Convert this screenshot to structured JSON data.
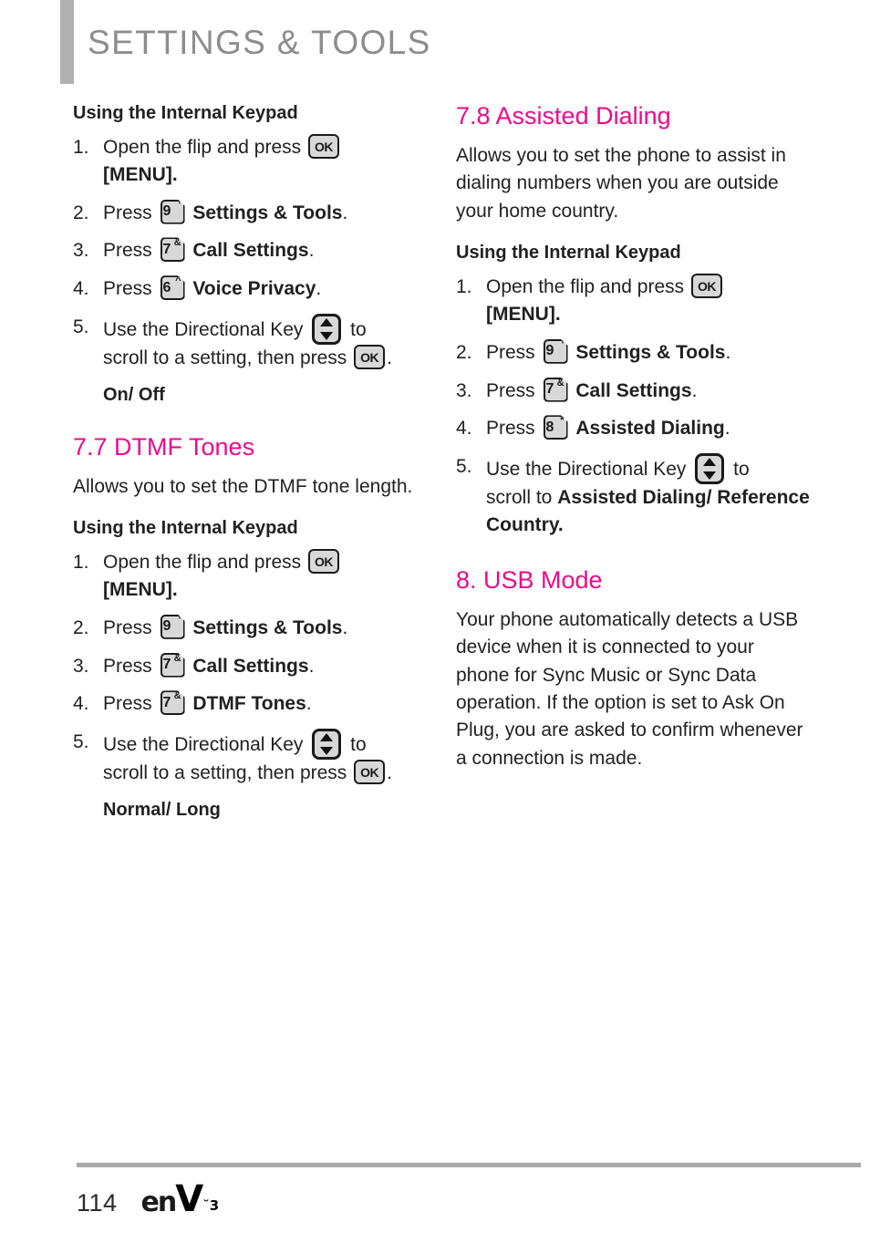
{
  "header": {
    "title": "SETTINGS & TOOLS",
    "accent_gray": "#8d8d8d",
    "bar_color": "#b0b0b0"
  },
  "colors": {
    "heading_magenta": "#ec0a8c",
    "body_black": "#231f20"
  },
  "left_column": {
    "blocks": [
      {
        "kind": "sub-heading",
        "text": "Using the Internal Keypad"
      },
      {
        "kind": "steps",
        "items": [
          {
            "num": "1.",
            "pre": "Open the flip and press ",
            "icon": "ok-key",
            "post": "",
            "line2_bold": "[MENU]."
          },
          {
            "num": "2.",
            "pre": "Press ",
            "icon": "num-key",
            "key_digit": "9",
            "key_sup": "‘",
            "post_bold": "Settings & Tools",
            "post": "."
          },
          {
            "num": "3.",
            "pre": "Press ",
            "icon": "num-key",
            "key_digit": "7",
            "key_sup": "&",
            "post_bold": "Call Settings",
            "post": "."
          },
          {
            "num": "4.",
            "pre": "Press ",
            "icon": "num-key",
            "key_digit": "6",
            "key_sup": "^",
            "post_bold": "Voice Privacy",
            "post": "."
          },
          {
            "num": "5.",
            "pre": "Use the Directional Key ",
            "icon": "dir-key",
            "mid": " to",
            "line2_pre": "scroll to a setting, then press ",
            "line2_icon": "ok-key",
            "line2_post": "."
          }
        ]
      },
      {
        "kind": "option",
        "text": "On/ Off"
      },
      {
        "kind": "sec-heading",
        "text": "7.7 DTMF Tones"
      },
      {
        "kind": "body",
        "text": "Allows you to set the DTMF tone length."
      },
      {
        "kind": "sub-heading",
        "text": "Using the Internal Keypad"
      },
      {
        "kind": "steps",
        "items": [
          {
            "num": "1.",
            "pre": "Open the flip and press ",
            "icon": "ok-key",
            "line2_bold": "[MENU]."
          },
          {
            "num": "2.",
            "pre": "Press ",
            "icon": "num-key",
            "key_digit": "9",
            "key_sup": "‘",
            "post_bold": "Settings & Tools",
            "post": "."
          },
          {
            "num": "3.",
            "pre": "Press ",
            "icon": "num-key",
            "key_digit": "7",
            "key_sup": "&",
            "post_bold": "Call Settings",
            "post": "."
          },
          {
            "num": "4.",
            "pre": "Press ",
            "icon": "num-key",
            "key_digit": "7",
            "key_sup": "&",
            "post_bold": "DTMF Tones",
            "post": "."
          },
          {
            "num": "5.",
            "pre": "Use the Directional Key ",
            "icon": "dir-key",
            "mid": " to",
            "line2_pre": "scroll to a setting, then press ",
            "line2_icon": "ok-key",
            "line2_post": "."
          }
        ]
      },
      {
        "kind": "option",
        "text": "Normal/ Long"
      }
    ]
  },
  "right_column": {
    "blocks": [
      {
        "kind": "sec-heading",
        "text": "7.8 Assisted Dialing"
      },
      {
        "kind": "body",
        "text": "Allows you to set the phone to assist in dialing numbers when you are outside your home country."
      },
      {
        "kind": "sub-heading",
        "text": "Using the Internal Keypad"
      },
      {
        "kind": "steps",
        "items": [
          {
            "num": "1.",
            "pre": "Open the flip and press ",
            "icon": "ok-key",
            "line2_bold": "[MENU]."
          },
          {
            "num": "2.",
            "pre": "Press ",
            "icon": "num-key",
            "key_digit": "9",
            "key_sup": "‘",
            "post_bold": "Settings & Tools",
            "post": "."
          },
          {
            "num": "3.",
            "pre": "Press ",
            "icon": "num-key",
            "key_digit": "7",
            "key_sup": "&",
            "post_bold": "Call Settings",
            "post": "."
          },
          {
            "num": "4.",
            "pre": "Press ",
            "icon": "num-key",
            "key_digit": "8",
            "key_sup": "*",
            "post_bold": "Assisted Dialing",
            "post": "."
          },
          {
            "num": "5.",
            "pre": "Use the Directional Key ",
            "icon": "dir-key",
            "mid": " to",
            "line2_pre": "scroll to ",
            "line2_bold2": "Assisted Dialing/ Reference Country."
          }
        ]
      },
      {
        "kind": "sec-heading",
        "text": "8. USB Mode"
      },
      {
        "kind": "body",
        "text": "Your phone automatically detects a USB device when it is connected to your phone for Sync Music or Sync Data operation. If the option is set to Ask On Plug, you are asked to confirm whenever a connection is made."
      }
    ]
  },
  "footer": {
    "page_number": "114",
    "logo_en": "en",
    "logo_v": "V",
    "logo_sup": "˘3"
  }
}
